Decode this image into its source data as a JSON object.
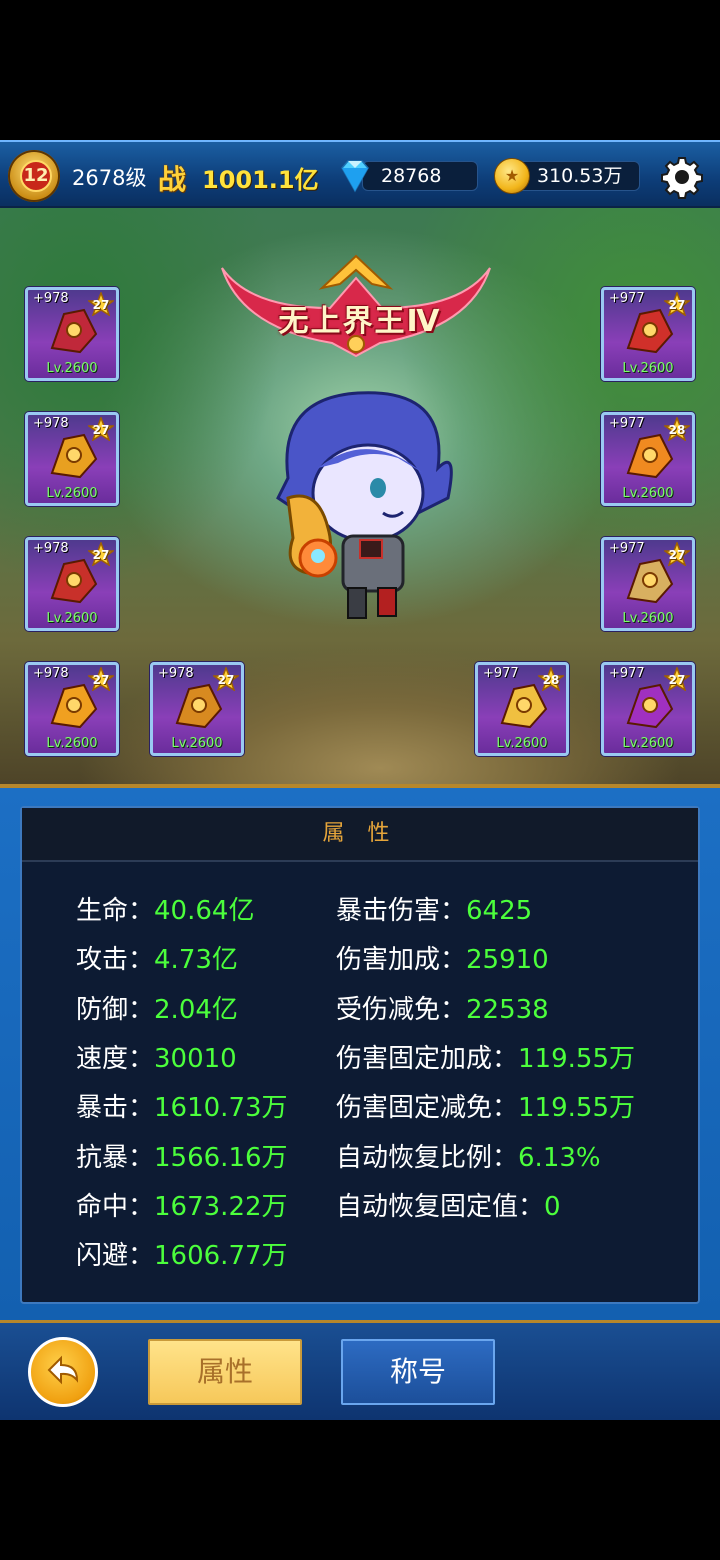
{
  "header": {
    "vip_level": "12",
    "player_level": "2678级",
    "power_label": "战",
    "power_value": "1001.1亿",
    "diamonds": "28768",
    "gold": "310.53万",
    "icons": {
      "vip": "vip-badge-icon",
      "diamond": "diamond-icon",
      "gold": "gold-coin-icon",
      "settings": "gear-icon"
    }
  },
  "scene": {
    "title": "无上界王Ⅳ",
    "equipment": [
      {
        "enhance": "+978",
        "stars": "27",
        "level": "Lv.2600",
        "icon": "weapon-icon"
      },
      {
        "enhance": "+978",
        "stars": "27",
        "level": "Lv.2600",
        "icon": "armor-icon"
      },
      {
        "enhance": "+978",
        "stars": "27",
        "level": "Lv.2600",
        "icon": "boots-icon"
      },
      {
        "enhance": "+978",
        "stars": "27",
        "level": "Lv.2600",
        "icon": "pants-icon"
      },
      {
        "enhance": "+978",
        "stars": "27",
        "level": "Lv.2600",
        "icon": "belt-icon"
      },
      {
        "enhance": "+977",
        "stars": "27",
        "level": "Lv.2600",
        "icon": "helmet-icon"
      },
      {
        "enhance": "+977",
        "stars": "28",
        "level": "Lv.2600",
        "icon": "bracer-icon"
      },
      {
        "enhance": "+977",
        "stars": "27",
        "level": "Lv.2600",
        "icon": "necklace-icon"
      },
      {
        "enhance": "+977",
        "stars": "28",
        "level": "Lv.2600",
        "icon": "ring-icon"
      },
      {
        "enhance": "+977",
        "stars": "27",
        "level": "Lv.2600",
        "icon": "amulet-icon"
      }
    ]
  },
  "panel": {
    "title": "属 性",
    "left_stats": [
      {
        "label": "生命：",
        "value": "40.64亿"
      },
      {
        "label": "攻击：",
        "value": "4.73亿"
      },
      {
        "label": "防御：",
        "value": "2.04亿"
      },
      {
        "label": "速度：",
        "value": "30010"
      },
      {
        "label": "暴击：",
        "value": "1610.73万"
      },
      {
        "label": "抗暴：",
        "value": "1566.16万"
      },
      {
        "label": "命中：",
        "value": "1673.22万"
      },
      {
        "label": "闪避：",
        "value": "1606.77万"
      }
    ],
    "right_stats": [
      {
        "label": "暴击伤害：",
        "value": "6425"
      },
      {
        "label": "伤害加成：",
        "value": "25910"
      },
      {
        "label": "受伤减免：",
        "value": "22538"
      },
      {
        "label": "伤害固定加成：",
        "value": "119.55万"
      },
      {
        "label": "伤害固定减免：",
        "value": "119.55万"
      },
      {
        "label": "自动恢复比例：",
        "value": "6.13%"
      },
      {
        "label": "自动恢复固定值：",
        "value": "0"
      }
    ]
  },
  "bottom": {
    "back_icon": "back-arrow-icon",
    "tabs": [
      {
        "label": "属性",
        "selected": true
      },
      {
        "label": "称号",
        "selected": false
      }
    ]
  },
  "colors": {
    "stat_value": "#4cff3c",
    "level_text": "#7cff6a",
    "panel_title": "#e6a53a",
    "power": "#ffe23c"
  }
}
